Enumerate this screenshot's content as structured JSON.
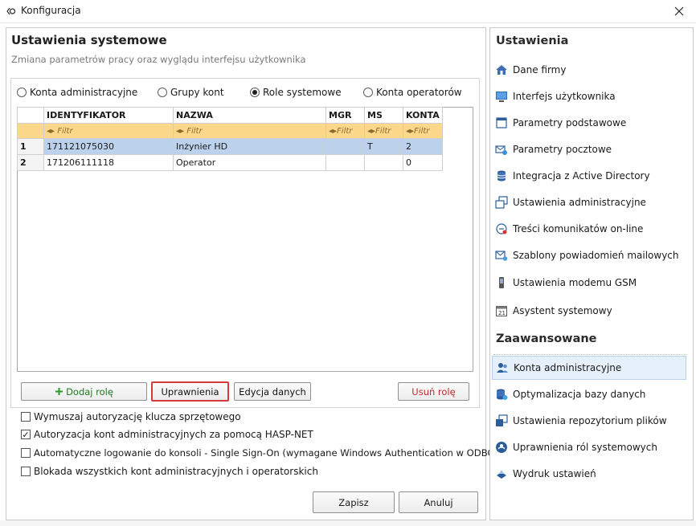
{
  "window": {
    "title": "Konfiguracja"
  },
  "main": {
    "title": "Ustawienia systemowe",
    "subtitle": "Zmiana parametrów pracy oraz wyglądu interfejsu użytkownika",
    "radios": [
      {
        "label": "Konta administracyjne",
        "checked": false
      },
      {
        "label": "Grupy kont",
        "checked": false
      },
      {
        "label": "Role systemowe",
        "checked": true
      },
      {
        "label": "Konta operatorów",
        "checked": false
      }
    ],
    "grid": {
      "columns": [
        "IDENTYFIKATOR",
        "NAZWA",
        "MGR",
        "MS",
        "KONTA"
      ],
      "filter_placeholder": "Filtr",
      "filter_icon": "filter-arrows-icon",
      "rows": [
        {
          "num": "1",
          "cells": [
            "171121075030",
            "Inżynier HD",
            "",
            "T",
            "2"
          ]
        },
        {
          "num": "2",
          "cells": [
            "171206111118",
            "Operator",
            "",
            "",
            "0"
          ]
        }
      ]
    },
    "buttons": {
      "add_role": "Dodaj rolę",
      "permissions": "Uprawnienia",
      "edit_data": "Edycja danych",
      "remove_role": "Usuń rolę"
    },
    "checkboxes": [
      {
        "label": "Wymuszaj autoryzację klucza sprzętowego",
        "checked": false
      },
      {
        "label": "Autoryzacja kont administracyjnych za pomocą HASP-NET",
        "checked": true
      },
      {
        "label": "Automatyczne logowanie do konsoli - Single Sign-On (wymagane Windows Authentication w ODBC)",
        "checked": false
      },
      {
        "label": "Blokada wszystkich kont administracyjnych i operatorskich",
        "checked": false
      }
    ],
    "footer": {
      "save": "Zapisz",
      "cancel": "Anuluj"
    }
  },
  "sidebar": {
    "settings_title": "Ustawienia",
    "settings_items": [
      {
        "label": "Dane firmy",
        "icon": "home-icon"
      },
      {
        "label": "Interfejs użytkownika",
        "icon": "monitor-icon"
      },
      {
        "label": "Parametry podstawowe",
        "icon": "window-icon"
      },
      {
        "label": "Parametry pocztowe",
        "icon": "mail-settings-icon"
      },
      {
        "label": "Integracja z Active Directory",
        "icon": "database-icon"
      },
      {
        "label": "Ustawienia administracyjne",
        "icon": "windows-stack-icon"
      },
      {
        "label": "Treści komunikatów on-line",
        "icon": "message-icon"
      },
      {
        "label": "Szablony powiadomień mailowych",
        "icon": "mail-template-icon"
      },
      {
        "label": "Ustawienia modemu GSM",
        "icon": "phone-icon"
      },
      {
        "label": "Asystent systemowy",
        "icon": "calendar-icon"
      }
    ],
    "advanced_title": "Zaawansowane",
    "advanced_items": [
      {
        "label": "Konta administracyjne",
        "icon": "users-icon",
        "active": true
      },
      {
        "label": "Optymalizacja bazy danych",
        "icon": "database-optimize-icon",
        "active": false
      },
      {
        "label": "Ustawienia repozytorium plików",
        "icon": "repository-icon",
        "active": false
      },
      {
        "label": "Uprawnienia ról systemowych",
        "icon": "roles-icon",
        "active": false
      },
      {
        "label": "Wydruk ustawień",
        "icon": "print-icon",
        "active": false
      }
    ]
  }
}
